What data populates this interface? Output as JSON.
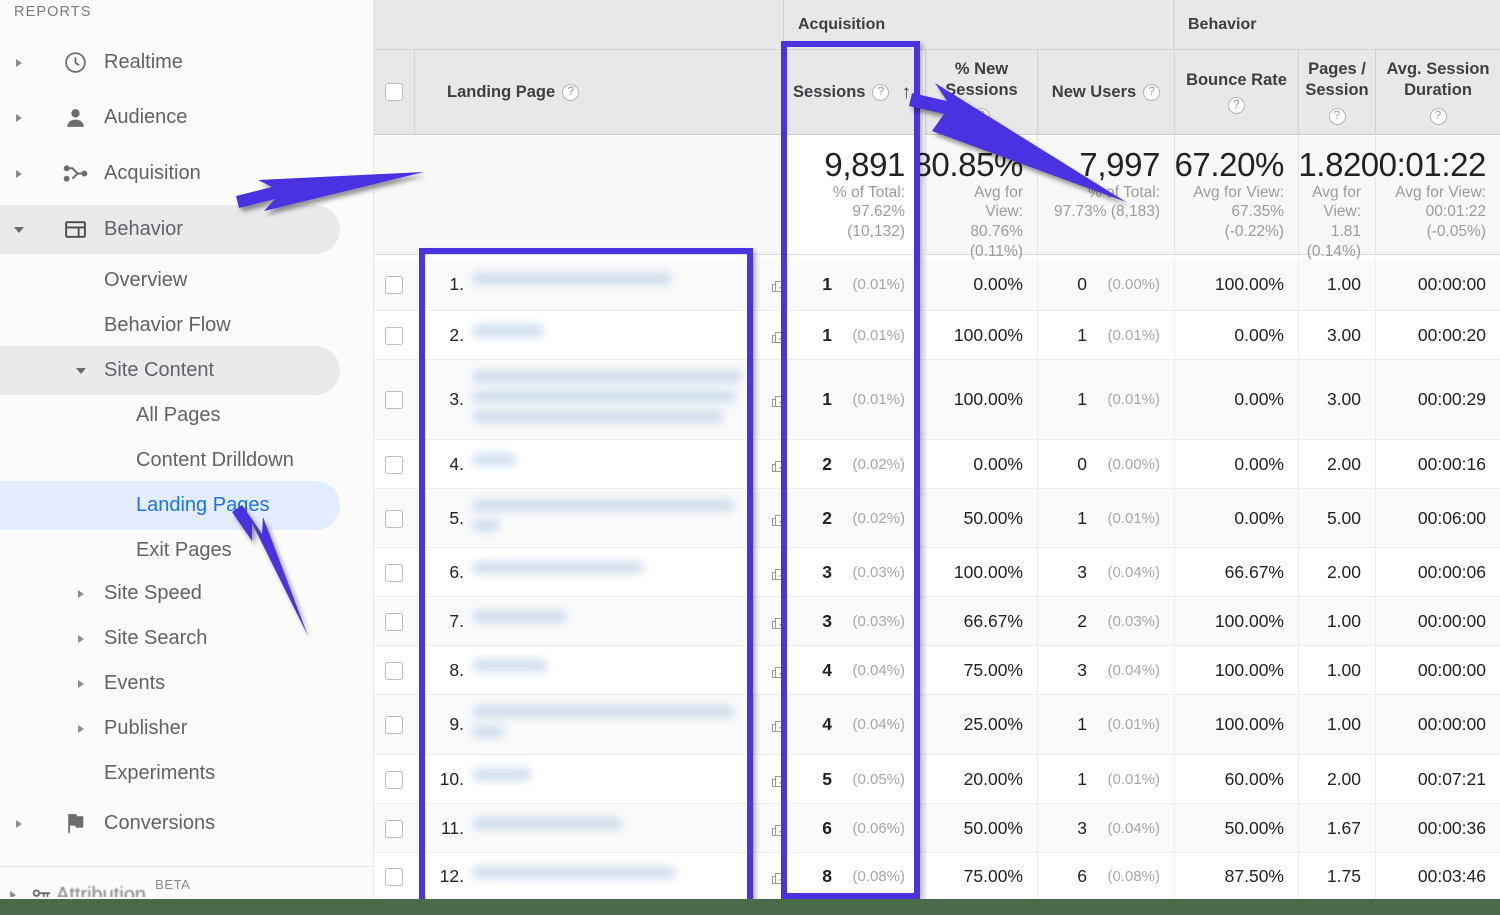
{
  "sidebar": {
    "section_label": "REPORTS",
    "items": [
      {
        "label": "Realtime",
        "icon": "clock-icon",
        "level": 1,
        "caret": "right",
        "state": "normal"
      },
      {
        "label": "Audience",
        "icon": "person-icon",
        "level": 1,
        "caret": "right",
        "state": "normal"
      },
      {
        "label": "Acquisition",
        "icon": "share-icon",
        "level": 1,
        "caret": "right",
        "state": "normal"
      },
      {
        "label": "Behavior",
        "icon": "pages-icon",
        "level": 1,
        "caret": "down",
        "state": "active-grey"
      },
      {
        "label": "Overview",
        "icon": "",
        "level": 2,
        "caret": "none",
        "state": "normal"
      },
      {
        "label": "Behavior Flow",
        "icon": "",
        "level": 2,
        "caret": "none",
        "state": "normal"
      },
      {
        "label": "Site Content",
        "icon": "",
        "level": 2,
        "caret": "down",
        "state": "active-grey"
      },
      {
        "label": "All Pages",
        "icon": "",
        "level": 3,
        "caret": "none",
        "state": "normal"
      },
      {
        "label": "Content Drilldown",
        "icon": "",
        "level": 3,
        "caret": "none",
        "state": "normal"
      },
      {
        "label": "Landing Pages",
        "icon": "",
        "level": 3,
        "caret": "none",
        "state": "selected"
      },
      {
        "label": "Exit Pages",
        "icon": "",
        "level": 3,
        "caret": "none",
        "state": "normal"
      },
      {
        "label": "Site Speed",
        "icon": "",
        "level": 2,
        "caret": "right",
        "state": "normal"
      },
      {
        "label": "Site Search",
        "icon": "",
        "level": 2,
        "caret": "right",
        "state": "normal"
      },
      {
        "label": "Events",
        "icon": "",
        "level": 2,
        "caret": "right",
        "state": "normal"
      },
      {
        "label": "Publisher",
        "icon": "",
        "level": 2,
        "caret": "right",
        "state": "normal"
      },
      {
        "label": "Experiments",
        "icon": "",
        "level": 2,
        "caret": "none",
        "state": "normal"
      },
      {
        "label": "Conversions",
        "icon": "flag-icon",
        "level": 1,
        "caret": "right",
        "state": "normal"
      }
    ],
    "footer": {
      "label": "Attribution",
      "badge": "BETA",
      "icon": "key-icon"
    }
  },
  "table": {
    "groups": [
      {
        "label": "Acquisition"
      },
      {
        "label": "Behavior"
      }
    ],
    "columns": [
      {
        "key": "landing_page",
        "label": "Landing Page",
        "help": "?",
        "sorted": false
      },
      {
        "key": "sessions",
        "label": "Sessions",
        "help": "?",
        "sorted": true,
        "sort_dir": "ascending",
        "sort_glyph": "↑"
      },
      {
        "key": "pct_new",
        "label": "% New\nSessions",
        "help": "?",
        "sorted": false
      },
      {
        "key": "new_users",
        "label": "New Users",
        "help": "?",
        "sorted": false
      },
      {
        "key": "bounce_rate",
        "label": "Bounce Rate",
        "help": "?",
        "sorted": false
      },
      {
        "key": "pages_sess",
        "label": "Pages /\nSession",
        "help": "?",
        "sorted": false
      },
      {
        "key": "avg_dur",
        "label": "Avg. Session\nDuration",
        "help": "?",
        "sorted": false
      }
    ],
    "summary": {
      "sessions": {
        "value": "9,891",
        "sub1": "% of Total:",
        "sub2": "97.62% (10,132)"
      },
      "pct_new": {
        "value": "80.85%",
        "sub1": "Avg for View:",
        "sub2": "80.76%",
        "sub3": "(0.11%)"
      },
      "new_users": {
        "value": "7,997",
        "sub1": "% of Total:",
        "sub2": "97.73% (8,183)"
      },
      "bounce_rate": {
        "value": "67.20%",
        "sub1": "Avg for View:",
        "sub2": "67.35%",
        "sub3": "(-0.22%)"
      },
      "pages_sess": {
        "value": "1.82",
        "sub1": "Avg for",
        "sub2": "View:",
        "sub3": "1.81",
        "sub4": "(0.14%)"
      },
      "avg_dur": {
        "value": "00:01:22",
        "sub1": "Avg for View:",
        "sub2": "00:01:22",
        "sub3": "(-0.05%)"
      }
    },
    "rows": [
      {
        "index": "1.",
        "landing_page": "",
        "sessions": "1",
        "sessions_pct": "(0.01%)",
        "pct_new": "0.00%",
        "new_users": "0",
        "new_users_pct": "(0.00%)",
        "bounce_rate": "100.00%",
        "pages_sess": "1.00",
        "avg_dur": "00:00:00"
      },
      {
        "index": "2.",
        "landing_page": "",
        "sessions": "1",
        "sessions_pct": "(0.01%)",
        "pct_new": "100.00%",
        "new_users": "1",
        "new_users_pct": "(0.01%)",
        "bounce_rate": "0.00%",
        "pages_sess": "3.00",
        "avg_dur": "00:00:20"
      },
      {
        "index": "3.",
        "landing_page": "",
        "sessions": "1",
        "sessions_pct": "(0.01%)",
        "pct_new": "100.00%",
        "new_users": "1",
        "new_users_pct": "(0.01%)",
        "bounce_rate": "0.00%",
        "pages_sess": "3.00",
        "avg_dur": "00:00:29"
      },
      {
        "index": "4.",
        "landing_page": "",
        "sessions": "2",
        "sessions_pct": "(0.02%)",
        "pct_new": "0.00%",
        "new_users": "0",
        "new_users_pct": "(0.00%)",
        "bounce_rate": "0.00%",
        "pages_sess": "2.00",
        "avg_dur": "00:00:16"
      },
      {
        "index": "5.",
        "landing_page": "",
        "sessions": "2",
        "sessions_pct": "(0.02%)",
        "pct_new": "50.00%",
        "new_users": "1",
        "new_users_pct": "(0.01%)",
        "bounce_rate": "0.00%",
        "pages_sess": "5.00",
        "avg_dur": "00:06:00"
      },
      {
        "index": "6.",
        "landing_page": "",
        "sessions": "3",
        "sessions_pct": "(0.03%)",
        "pct_new": "100.00%",
        "new_users": "3",
        "new_users_pct": "(0.04%)",
        "bounce_rate": "66.67%",
        "pages_sess": "2.00",
        "avg_dur": "00:00:06"
      },
      {
        "index": "7.",
        "landing_page": "",
        "sessions": "3",
        "sessions_pct": "(0.03%)",
        "pct_new": "66.67%",
        "new_users": "2",
        "new_users_pct": "(0.03%)",
        "bounce_rate": "100.00%",
        "pages_sess": "1.00",
        "avg_dur": "00:00:00"
      },
      {
        "index": "8.",
        "landing_page": "",
        "sessions": "4",
        "sessions_pct": "(0.04%)",
        "pct_new": "75.00%",
        "new_users": "3",
        "new_users_pct": "(0.04%)",
        "bounce_rate": "100.00%",
        "pages_sess": "1.00",
        "avg_dur": "00:00:00"
      },
      {
        "index": "9.",
        "landing_page": "",
        "sessions": "4",
        "sessions_pct": "(0.04%)",
        "pct_new": "25.00%",
        "new_users": "1",
        "new_users_pct": "(0.01%)",
        "bounce_rate": "100.00%",
        "pages_sess": "1.00",
        "avg_dur": "00:00:00"
      },
      {
        "index": "10.",
        "landing_page": "",
        "sessions": "5",
        "sessions_pct": "(0.05%)",
        "pct_new": "20.00%",
        "new_users": "1",
        "new_users_pct": "(0.01%)",
        "bounce_rate": "60.00%",
        "pages_sess": "2.00",
        "avg_dur": "00:07:21"
      },
      {
        "index": "11.",
        "landing_page": "",
        "sessions": "6",
        "sessions_pct": "(0.06%)",
        "pct_new": "50.00%",
        "new_users": "3",
        "new_users_pct": "(0.04%)",
        "bounce_rate": "50.00%",
        "pages_sess": "1.67",
        "avg_dur": "00:00:36"
      },
      {
        "index": "12.",
        "landing_page": "",
        "sessions": "8",
        "sessions_pct": "(0.08%)",
        "pct_new": "75.00%",
        "new_users": "6",
        "new_users_pct": "(0.08%)",
        "bounce_rate": "87.50%",
        "pages_sess": "1.75",
        "avg_dur": "00:03:46"
      }
    ]
  },
  "annotations": {
    "accent_color": "#4b33e0",
    "highlight_boxes": [
      {
        "name": "landing-page-column-highlight"
      },
      {
        "name": "sessions-column-highlight"
      }
    ],
    "arrows": [
      {
        "name": "arrow-to-behavior",
        "points_to": "Behavior"
      },
      {
        "name": "arrow-to-landing-pages",
        "points_to": "Landing Pages"
      },
      {
        "name": "arrow-to-sessions",
        "points_to": "Sessions"
      }
    ]
  }
}
